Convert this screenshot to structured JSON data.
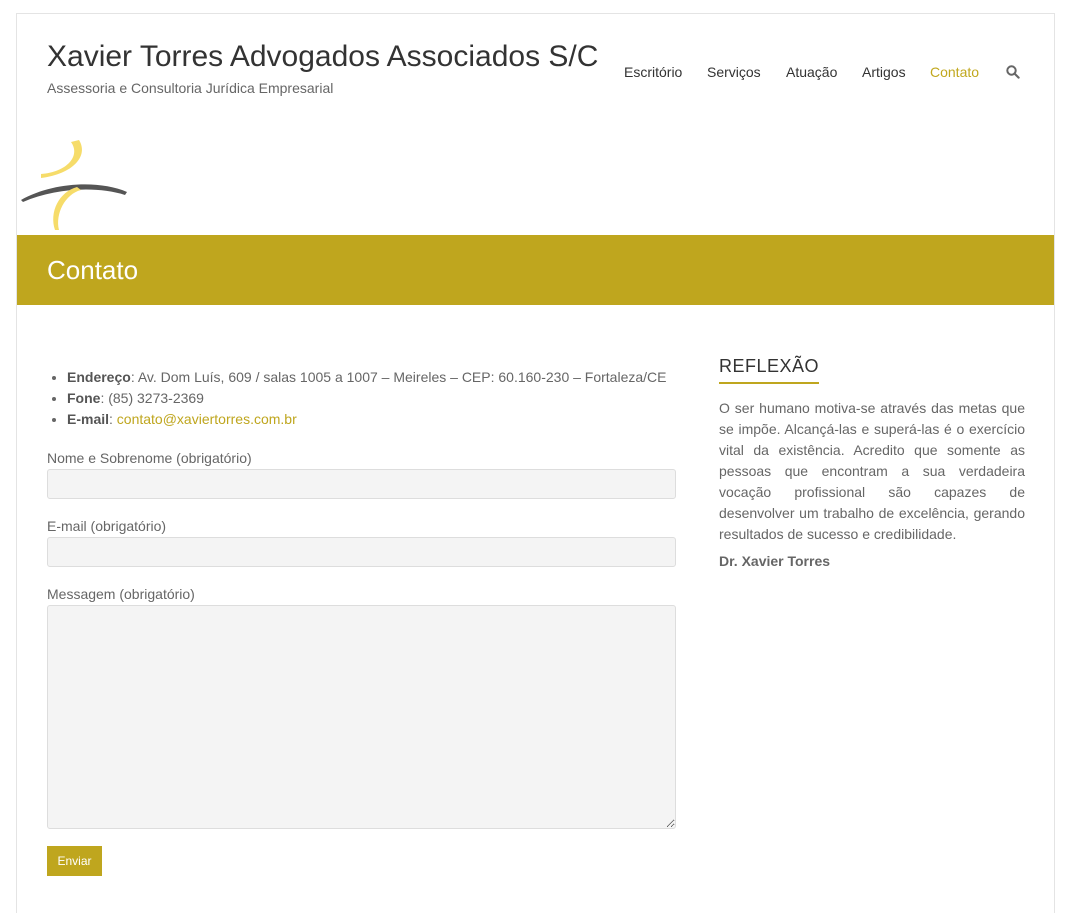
{
  "header": {
    "site_title": "Xavier Torres Advogados Associados S/C",
    "site_description": "Assessoria e Consultoria Jurídica Empresarial"
  },
  "nav": {
    "items": [
      {
        "label": "Escritório"
      },
      {
        "label": "Serviços"
      },
      {
        "label": "Atuação"
      },
      {
        "label": "Artigos"
      },
      {
        "label": "Contato",
        "active": true
      }
    ],
    "search_icon": "search-icon"
  },
  "page": {
    "title": "Contato"
  },
  "contact_info": {
    "address_label": "Endereço",
    "address_value": ": Av. Dom Luís, 609 / salas 1005 a 1007 – Meireles – CEP: 60.160-230 – Fortaleza/CE",
    "phone_label": "Fone",
    "phone_value": ": (85) 3273-2369",
    "email_label": "E-mail",
    "email_sep": ": ",
    "email_value": "contato@xaviertorres.com.br"
  },
  "form": {
    "name_label": "Nome e Sobrenome (obrigatório)",
    "name_value": "",
    "email_label": "E-mail (obrigatório)",
    "email_value": "",
    "message_label": "Messagem (obrigatório)",
    "message_value": "",
    "submit_label": "Enviar"
  },
  "sidebar": {
    "title": "REFLEXÃO",
    "text": "O ser humano motiva-se através das metas que se impõe. Alcançá-las e superá-las é o exercício vital da existência. Acredito que somente as pessoas que encontram a sua verdadeira vocação profissional são capazes de desenvolver um trabalho de excelência, gerando resultados de sucesso e credibilidade.",
    "author": "Dr. Xavier Torres"
  },
  "colors": {
    "accent": "#bfa61e",
    "logo_yellow": "#f6dc6a",
    "logo_gray": "#555555"
  }
}
